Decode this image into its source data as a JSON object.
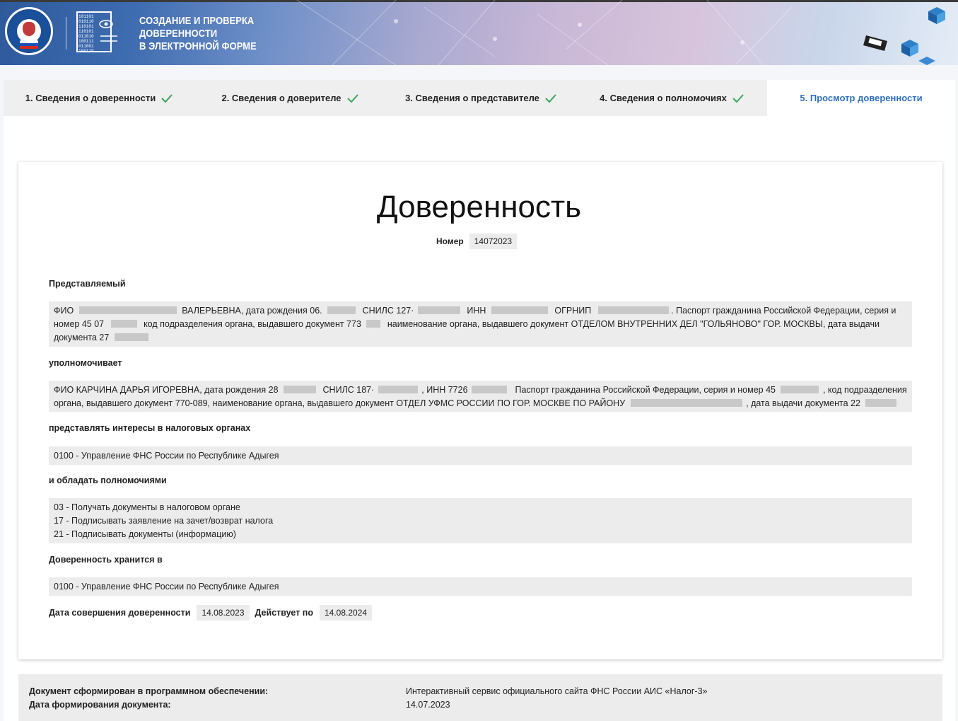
{
  "header": {
    "title_lines": [
      "СОЗДАНИЕ И ПРОВЕРКА",
      "ДОВЕРЕННОСТИ",
      "В ЭЛЕКТРОННОЙ ФОРМЕ"
    ],
    "logo_text": "ФЕДЕРАЛЬНАЯ НАЛОГОВАЯ СЛУЖБА",
    "doc_icon_binary": [
      "101101",
      "010110",
      "110101",
      "110101",
      "011010",
      "100111",
      "011001",
      "100110"
    ]
  },
  "tabs": [
    {
      "label": "1. Сведения о доверенности",
      "done": true
    },
    {
      "label": "2. Сведения о доверителе",
      "done": true
    },
    {
      "label": "3. Сведения о представителе",
      "done": true
    },
    {
      "label": "4. Сведения о полномочиях",
      "done": true
    },
    {
      "label": "5. Просмотр доверенности",
      "done": false,
      "active": true
    }
  ],
  "document": {
    "title": "Доверенность",
    "number_label": "Номер",
    "number": "14072023",
    "principal_label": "Представляемый",
    "principal": {
      "fio_label": "ФИО",
      "name_tail": "ВАЛЕРЬЕВНА, дата рождения 06.",
      "snils_label": "СНИЛС 127·",
      "inn_label": "ИНН",
      "ogrnip_label": "ОГРНИП",
      "passport": ". Паспорт гражданина Российской Федерации, серия и",
      "line2_a": "номер 45 07",
      "line2_b": "код подразделения органа, выдавшего документ 773",
      "line2_c": "наименование органа, выдавшего документ ОТДЕЛОМ ВНУТРЕННИХ ДЕЛ \"ГОЛЬЯНОВО\" ГОР. МОСКВЫ, дата выдачи",
      "line3": "документа 27"
    },
    "authorizes_label": "уполномочивает",
    "representative": {
      "line1_a": "ФИО КАРЧИНА ДАРЬЯ ИГОРЕВНА, дата рождения 28",
      "line1_b": "СНИЛС 187·",
      "line1_c": ", ИНН 7726",
      "line1_d": "Паспорт гражданина Российской Федерации, серия и номер 45",
      "line1_e": ", код подразделения",
      "line2_a": "органа, выдавшего документ 770-089, наименование органа, выдавшего документ ОТДЕЛ УФМС РОССИИ ПО ГОР. МОСКВЕ ПО РАЙОНУ",
      "line2_b": ", дата выдачи документа 22"
    },
    "represent_label": "представлять интересы в налоговых органах",
    "tax_office": "0100 - Управление ФНС России по Республике Адыгея",
    "powers_label": "и обладать полномочиями",
    "powers": [
      "03 - Получать документы в налоговом органе",
      "17 - Подписывать заявление на зачет/возврат налога",
      "21 - Подписывать документы (информацию)"
    ],
    "stored_label": "Доверенность хранится в",
    "stored_in": "0100 - Управление ФНС России по Республике Адыгея",
    "date_label": "Дата совершения доверенности",
    "date": "14.08.2023",
    "valid_label": "Действует по",
    "valid_until": "14.08.2024"
  },
  "footer": {
    "software_label": "Документ сформирован в программном обеспечении:",
    "software_value": "Интерактивный сервис официального сайта ФНС России АИС «Налог-3»",
    "date_label": "Дата формирования документа:",
    "date_value": "14.07.2023"
  },
  "colors": {
    "accent": "#2d6fc1",
    "check": "#3aa657",
    "chip": "#ececec"
  }
}
